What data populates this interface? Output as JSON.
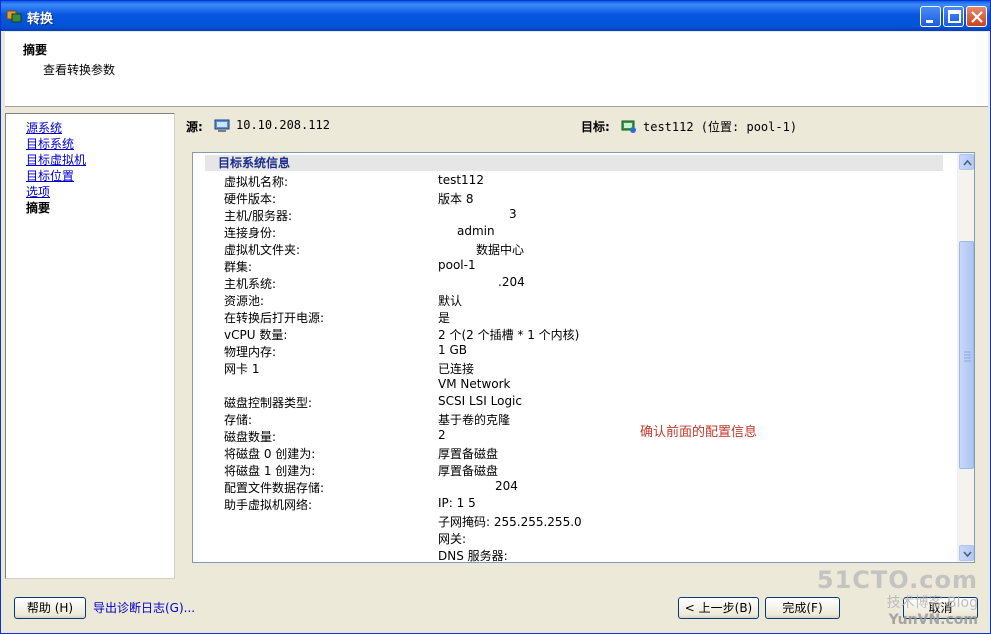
{
  "window": {
    "title": "转换"
  },
  "header": {
    "title": "摘要",
    "subtitle": "查看转换参数"
  },
  "nav": {
    "items": [
      {
        "label": "源系统",
        "current": false
      },
      {
        "label": "目标系统",
        "current": false
      },
      {
        "label": "目标虚拟机",
        "current": false
      },
      {
        "label": "目标位置",
        "current": false
      },
      {
        "label": "选项",
        "current": false
      },
      {
        "label": "摘要",
        "current": true
      }
    ]
  },
  "source": {
    "label": "源:",
    "value": "10.10.208.112",
    "icon": "computer-icon"
  },
  "target": {
    "label": "目标:",
    "value": "test112 (位置: pool-1)",
    "icon": "vm-icon"
  },
  "details": {
    "section_title": "目标系统信息",
    "rows": [
      {
        "key": "虚拟机名称:",
        "value": "test112"
      },
      {
        "key": "硬件版本:",
        "value": "版本 8"
      },
      {
        "key": "主机/服务器:",
        "value": "3"
      },
      {
        "key": "连接身份:",
        "value": "admin"
      },
      {
        "key": "虚拟机文件夹:",
        "value": "数据中心"
      },
      {
        "key": "群集:",
        "value": "pool-1"
      },
      {
        "key": "主机系统:",
        "value": ".204"
      },
      {
        "key": "资源池:",
        "value": "默认"
      },
      {
        "key": "在转换后打开电源:",
        "value": "是"
      },
      {
        "key": "vCPU 数量:",
        "value": "2 个(2 个插槽 * 1 个内核)"
      },
      {
        "key": "物理内存:",
        "value": "1 GB"
      },
      {
        "key": "网卡 1",
        "value": "已连接"
      },
      {
        "key": "",
        "value": "VM Network"
      },
      {
        "key": "磁盘控制器类型:",
        "value": "SCSI LSI Logic"
      },
      {
        "key": "存储:",
        "value": "基于卷的克隆"
      },
      {
        "key": "磁盘数量:",
        "value": "2"
      },
      {
        "key": "将磁盘 0 创建为:",
        "value": "厚置备磁盘"
      },
      {
        "key": "将磁盘 1 创建为:",
        "value": "厚置备磁盘"
      },
      {
        "key": "配置文件数据存储:",
        "value": "204"
      },
      {
        "key": "助手虚拟机网络:",
        "value": "IP: 1 5"
      },
      {
        "key": "",
        "value": "子网掩码: 255.255.255.0"
      },
      {
        "key": "",
        "value": "网关:"
      },
      {
        "key": "",
        "value": "DNS 服务器:"
      }
    ],
    "note": "确认前面的配置信息"
  },
  "footer": {
    "help_label": "帮助 (H)",
    "export_label": "导出诊断日志(G)...",
    "back_label": "< 上一步(B)",
    "finish_label": "完成(F)",
    "cancel_label": "取消"
  },
  "watermark": {
    "line1": "51CTO.com",
    "line2": "技术博客 Blog",
    "line3": "YunVN.com"
  }
}
